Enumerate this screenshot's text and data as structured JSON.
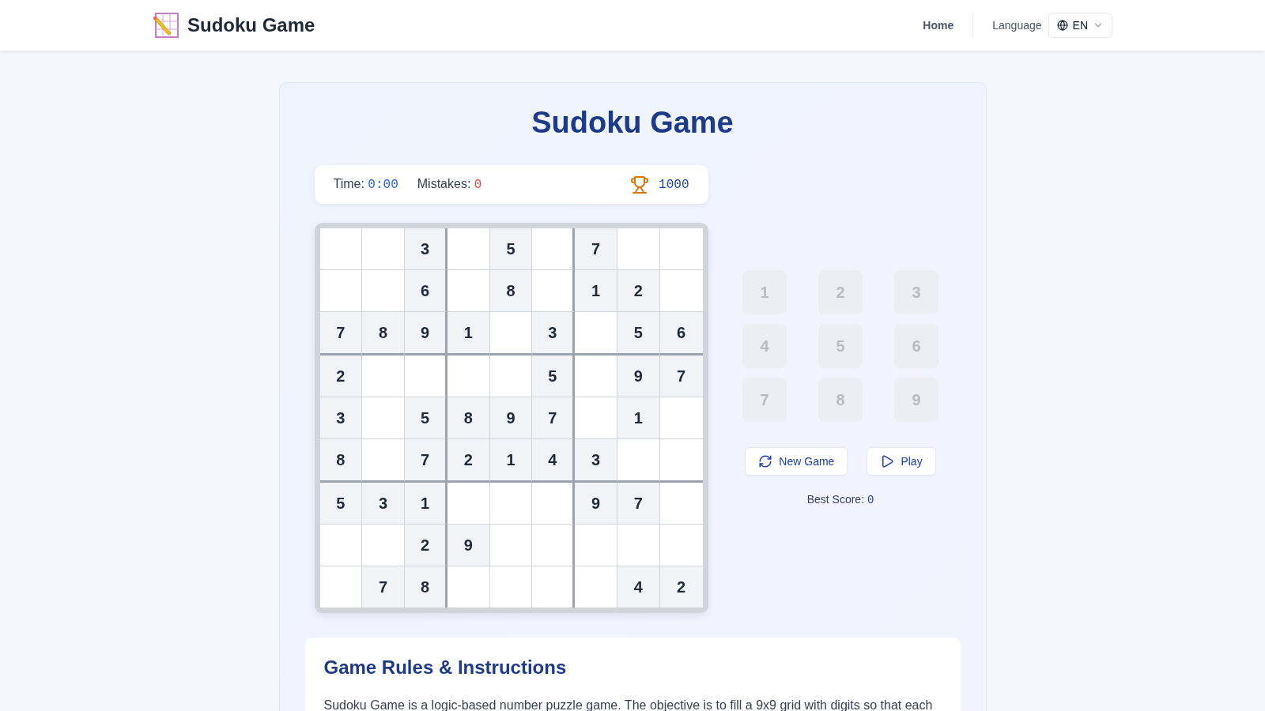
{
  "header": {
    "brand": "Sudoku Game",
    "nav": [
      {
        "label": "Home"
      }
    ],
    "language_label": "Language",
    "language": "EN"
  },
  "title": "Sudoku Game",
  "stats": {
    "time_label": "Time:",
    "time": "0:00",
    "mistakes_label": "Mistakes:",
    "mistakes": "0",
    "score": "1000"
  },
  "grid": [
    [
      {
        "given": false
      },
      {
        "given": false
      },
      {
        "given": true,
        "value": "3"
      },
      {
        "given": false
      },
      {
        "given": true,
        "value": "5"
      },
      {
        "given": false
      },
      {
        "given": true,
        "value": "7"
      },
      {
        "given": false
      },
      {
        "given": false
      }
    ],
    [
      {
        "given": false
      },
      {
        "given": false
      },
      {
        "given": true,
        "value": "6"
      },
      {
        "given": false
      },
      {
        "given": true,
        "value": "8"
      },
      {
        "given": false
      },
      {
        "given": true,
        "value": "1"
      },
      {
        "given": true,
        "value": "2"
      },
      {
        "given": false
      }
    ],
    [
      {
        "given": true,
        "value": "7"
      },
      {
        "given": true,
        "value": "8"
      },
      {
        "given": true,
        "value": "9"
      },
      {
        "given": true,
        "value": "1"
      },
      {
        "given": false
      },
      {
        "given": true,
        "value": "3"
      },
      {
        "given": false
      },
      {
        "given": true,
        "value": "5"
      },
      {
        "given": true,
        "value": "6"
      }
    ],
    [
      {
        "given": true,
        "value": "2"
      },
      {
        "given": false
      },
      {
        "given": false
      },
      {
        "given": false
      },
      {
        "given": false
      },
      {
        "given": true,
        "value": "5"
      },
      {
        "given": false
      },
      {
        "given": true,
        "value": "9"
      },
      {
        "given": true,
        "value": "7"
      }
    ],
    [
      {
        "given": true,
        "value": "3"
      },
      {
        "given": false
      },
      {
        "given": true,
        "value": "5"
      },
      {
        "given": true,
        "value": "8"
      },
      {
        "given": true,
        "value": "9"
      },
      {
        "given": true,
        "value": "7"
      },
      {
        "given": false
      },
      {
        "given": true,
        "value": "1"
      },
      {
        "given": false
      }
    ],
    [
      {
        "given": true,
        "value": "8"
      },
      {
        "given": false
      },
      {
        "given": true,
        "value": "7"
      },
      {
        "given": true,
        "value": "2"
      },
      {
        "given": true,
        "value": "1"
      },
      {
        "given": true,
        "value": "4"
      },
      {
        "given": true,
        "value": "3"
      },
      {
        "given": false
      },
      {
        "given": false
      }
    ],
    [
      {
        "given": true,
        "value": "5"
      },
      {
        "given": true,
        "value": "3"
      },
      {
        "given": true,
        "value": "1"
      },
      {
        "given": false
      },
      {
        "given": false
      },
      {
        "given": false
      },
      {
        "given": true,
        "value": "9"
      },
      {
        "given": true,
        "value": "7"
      },
      {
        "given": false
      }
    ],
    [
      {
        "given": false
      },
      {
        "given": false
      },
      {
        "given": true,
        "value": "2"
      },
      {
        "given": true,
        "value": "9"
      },
      {
        "given": false
      },
      {
        "given": false
      },
      {
        "given": false
      },
      {
        "given": false
      },
      {
        "given": false
      }
    ],
    [
      {
        "given": false
      },
      {
        "given": true,
        "value": "7"
      },
      {
        "given": true,
        "value": "8"
      },
      {
        "given": false
      },
      {
        "given": false
      },
      {
        "given": false
      },
      {
        "given": false
      },
      {
        "given": true,
        "value": "4"
      },
      {
        "given": true,
        "value": "2"
      }
    ]
  ],
  "number_pad": {
    "disabled": true,
    "keys": [
      "1",
      "2",
      "3",
      "4",
      "5",
      "6",
      "7",
      "8",
      "9"
    ]
  },
  "actions": [
    {
      "kind": "new",
      "label": "New Game"
    },
    {
      "kind": "play",
      "label": "Play"
    }
  ],
  "best_score": {
    "label": "Best Score:",
    "value": "0"
  },
  "rules": {
    "heading": "Game Rules & Instructions",
    "text": "Sudoku Game is a logic-based number puzzle game. The objective is to fill a 9x9 grid with digits so that each"
  }
}
